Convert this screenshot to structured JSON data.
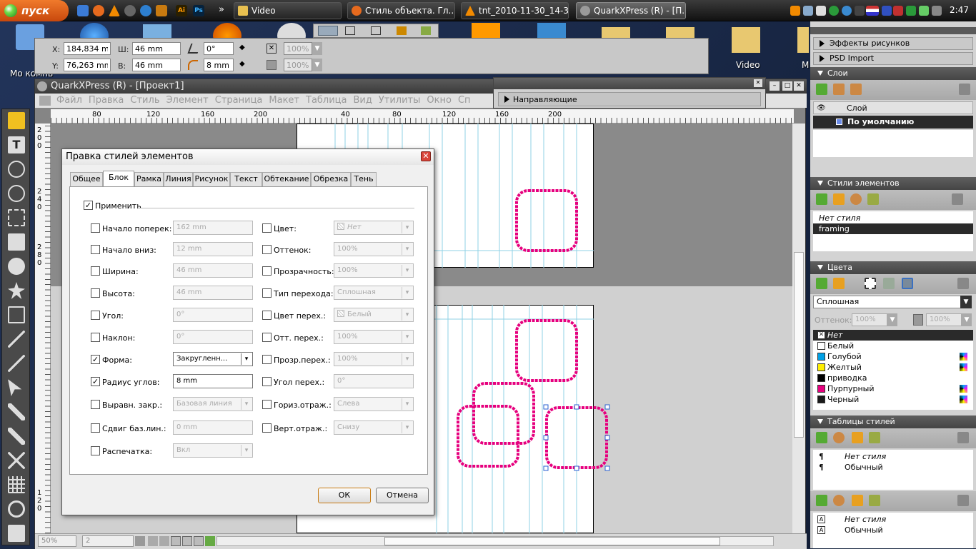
{
  "taskbar": {
    "start_label": "пуск",
    "quicklaunch_more": "»",
    "tasks": [
      {
        "label": "Video"
      },
      {
        "label": "Стиль объекта. Гл..."
      },
      {
        "label": "tnt_2010-11-30_14-3..."
      },
      {
        "label": "QuarkXPress (R) - [П..."
      }
    ],
    "clock": "2:47"
  },
  "desktop": {
    "icons": [
      {
        "label": "Мо компь"
      },
      {
        "label": "Video"
      },
      {
        "label": "М"
      }
    ]
  },
  "measurements": {
    "x_label": "X:",
    "x_value": "184,834 mm",
    "y_label": "Y:",
    "y_value": "76,263 mm",
    "w_label": "Ш:",
    "w_value": "46 mm",
    "h_label": "В:",
    "h_value": "46 mm",
    "angle_value": "0°",
    "radius_value": "8 mm",
    "opacity1": "100%",
    "opacity2": "100%"
  },
  "app": {
    "title": "QuarkXPress (R) - [Проект1]",
    "menu": [
      "Файл",
      "Правка",
      "Стиль",
      "Элемент",
      "Страница",
      "Макет",
      "Таблица",
      "Вид",
      "Утилиты",
      "Окно",
      "Сп"
    ],
    "ruler_top": [
      "80",
      "120",
      "160",
      "200",
      "40",
      "80",
      "120",
      "160",
      "200"
    ],
    "ruler_left": [
      "2\n0\n0",
      "2\n4\n0",
      "2\n8\n0",
      "1\n2\n0"
    ],
    "zoom": "50%",
    "page": "2"
  },
  "guides_palette": {
    "label": "Направляющие"
  },
  "dialog": {
    "title": "Правка стилей элементов",
    "tabs": [
      "Общее",
      "Блок",
      "Рамка",
      "Линия",
      "Рисунок",
      "Текст",
      "Обтекание",
      "Обрезка",
      "Тень"
    ],
    "apply_label": "Применить",
    "left_fields": [
      {
        "label": "Начало поперек:",
        "value": "162 mm",
        "checked": false
      },
      {
        "label": "Начало вниз:",
        "value": "12 mm",
        "checked": false
      },
      {
        "label": "Ширина:",
        "value": "46 mm",
        "checked": false
      },
      {
        "label": "Высота:",
        "value": "46 mm",
        "checked": false
      },
      {
        "label": "Угол:",
        "value": "0°",
        "checked": false
      },
      {
        "label": "Наклон:",
        "value": "0°",
        "checked": false
      },
      {
        "label": "Форма:",
        "value": "Закругленн...",
        "checked": true
      },
      {
        "label": "Радиус углов:",
        "value": "8 mm",
        "checked": true
      },
      {
        "label": "Выравн. закр.:",
        "value": "Базовая линия",
        "checked": false
      },
      {
        "label": "Сдвиг баз.лин.:",
        "value": "0 mm",
        "checked": false
      },
      {
        "label": "Распечатка:",
        "value": "Вкл",
        "checked": false
      }
    ],
    "right_fields": [
      {
        "label": "Цвет:",
        "value": "Нет"
      },
      {
        "label": "Оттенок:",
        "value": "100%"
      },
      {
        "label": "Прозрачность:",
        "value": "100%"
      },
      {
        "label": "Тип перехода:",
        "value": "Сплошная"
      },
      {
        "label": "Цвет перех.:",
        "value": "Белый"
      },
      {
        "label": "Отт. перех.:",
        "value": "100%"
      },
      {
        "label": "Прозр.перех.:",
        "value": "100%"
      },
      {
        "label": "Угол перех.:",
        "value": "0°"
      },
      {
        "label": "Гориз.отраж.:",
        "value": "Слева"
      },
      {
        "label": "Верт.отраж.:",
        "value": "Снизу"
      }
    ],
    "ok_label": "ОК",
    "cancel_label": "Отмена"
  },
  "palettes": {
    "effects": "Эффекты рисунков",
    "psd": "PSD Import",
    "layers": {
      "title": "Слои",
      "col_header": "Слой",
      "item": "По умолчанию"
    },
    "item_styles": {
      "title": "Стили элементов",
      "items": [
        "Нет стиля",
        "framing"
      ]
    },
    "colors": {
      "title": "Цвета",
      "mode": "Сплошная",
      "tint_label": "Оттенок:",
      "tint_value": "100%",
      "opacity_value": "100%",
      "items": [
        {
          "name": "Нет",
          "color": "#ffffff"
        },
        {
          "name": "Белый",
          "color": "#ffffff"
        },
        {
          "name": "Голубой",
          "color": "#00a0e6"
        },
        {
          "name": "Желтый",
          "color": "#ffee00"
        },
        {
          "name": "приводка",
          "color": "#000000"
        },
        {
          "name": "Пурпурный",
          "color": "#e6007e"
        },
        {
          "name": "Черный",
          "color": "#1a1a1a"
        }
      ]
    },
    "style_sheets": {
      "title": "Таблицы стилей",
      "para_items": [
        "Нет стиля",
        "Обычный"
      ],
      "char_items": [
        "Нет стиля",
        "Обычный"
      ]
    }
  },
  "colors": {
    "accent": "#e6007e",
    "guide": "#7fd0e0"
  }
}
